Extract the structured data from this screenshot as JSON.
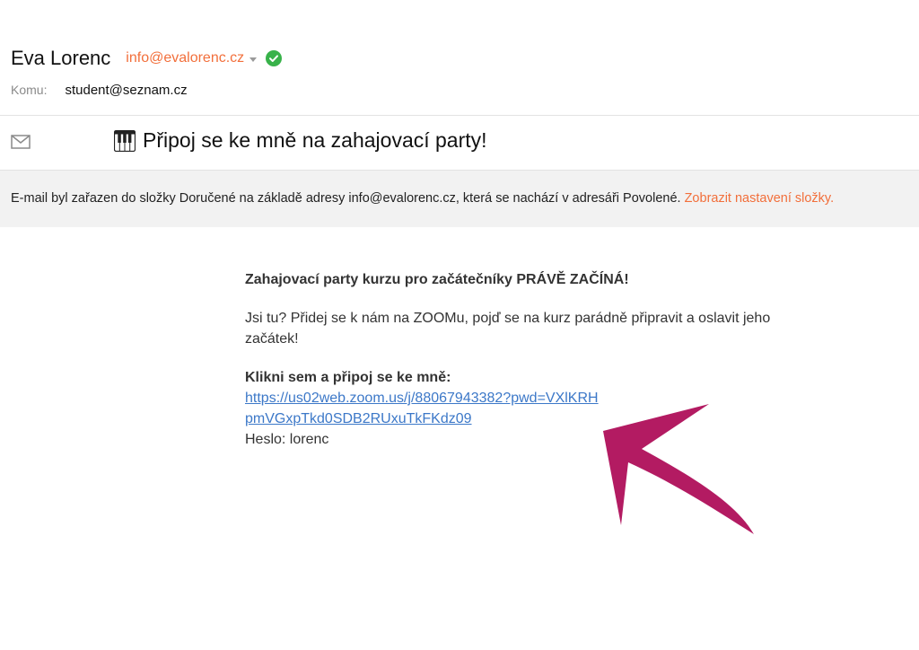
{
  "header": {
    "sender_name": "Eva Lorenc",
    "sender_email": "info@evalorenc.cz",
    "to_label": "Komu:",
    "to_value": "student@seznam.cz"
  },
  "subject": {
    "icon": "piano-icon",
    "text": "Připoj se ke mně na zahajovací party!"
  },
  "notice": {
    "text": "E-mail byl zařazen do složky Doručené na základě adresy info@evalorenc.cz, která se nachází v adresáři Povolené.",
    "link": "Zobrazit nastavení složky."
  },
  "message": {
    "heading": "Zahajovací party kurzu pro začátečníky PRÁVĚ ZAČÍNÁ!",
    "paragraph": "Jsi tu? Přidej se k nám na ZOOMu, pojď se na kurz parádně připravit a oslavit jeho začátek!",
    "cta": "Klikni sem a připoj se ke mně:",
    "link": "https://us02web.zoom.us/j/88067943382?pwd=VXlKRHpmVGxpTkd0SDB2RUxuTkFKdz09",
    "password": "Heslo: lorenc"
  },
  "colors": {
    "accent": "#f26f3b",
    "link": "#3c78c8",
    "verified": "#38b24a",
    "arrow": "#b31b62"
  }
}
